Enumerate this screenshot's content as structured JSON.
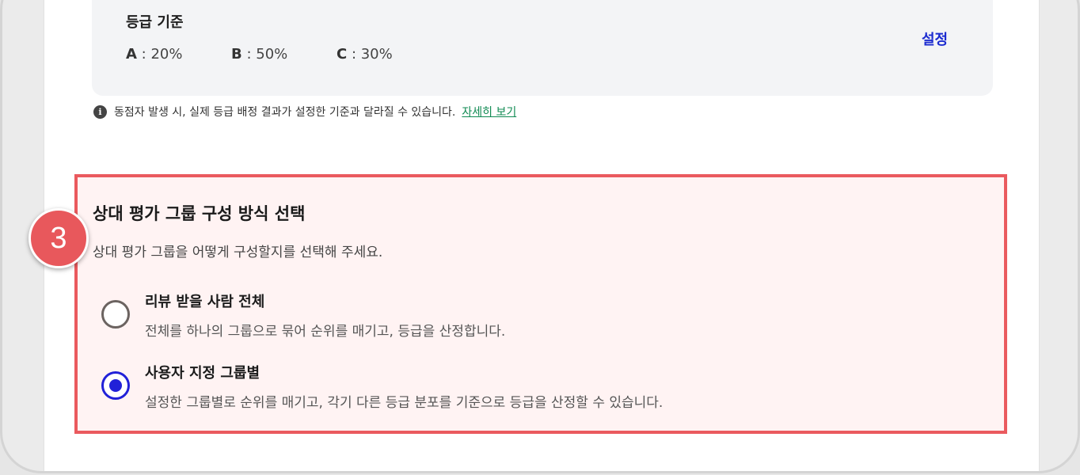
{
  "grade_criteria": {
    "title": "등급 기준",
    "items": [
      {
        "key": "A",
        "sep": " : ",
        "value": "20%"
      },
      {
        "key": "B",
        "sep": " : ",
        "value": "50%"
      },
      {
        "key": "C",
        "sep": " : ",
        "value": "30%"
      }
    ],
    "set_label": "설정"
  },
  "notice": {
    "icon": "info-icon",
    "text": "동점자 발생 시, 실제 등급 배정 결과가 설정한 기준과 달라질 수 있습니다.",
    "link": "자세히 보기"
  },
  "group_section": {
    "title": "상대 평가 그룹 구성 방식 선택",
    "description": "상대 평가 그룹을 어떻게 구성할지를 선택해 주세요.",
    "options": [
      {
        "title": "리뷰 받을 사람 전체",
        "description": "전체를 하나의 그룹으로 묶어 순위를 매기고, 등급을 산정합니다.",
        "selected": false
      },
      {
        "title": "사용자 지정 그룹별",
        "description": "설정한 그룹별로 순위를 매기고, 각기 다른 등급 분포를 기준으로 등급을 산정할 수 있습니다.",
        "selected": true
      }
    ]
  },
  "step_badge": "3",
  "colors": {
    "highlight_border": "#ea5a5e",
    "highlight_bg": "#fff3f3",
    "link_blue": "#1b2bd0",
    "link_green": "#0f8a52",
    "radio_selected": "#2121d8"
  }
}
